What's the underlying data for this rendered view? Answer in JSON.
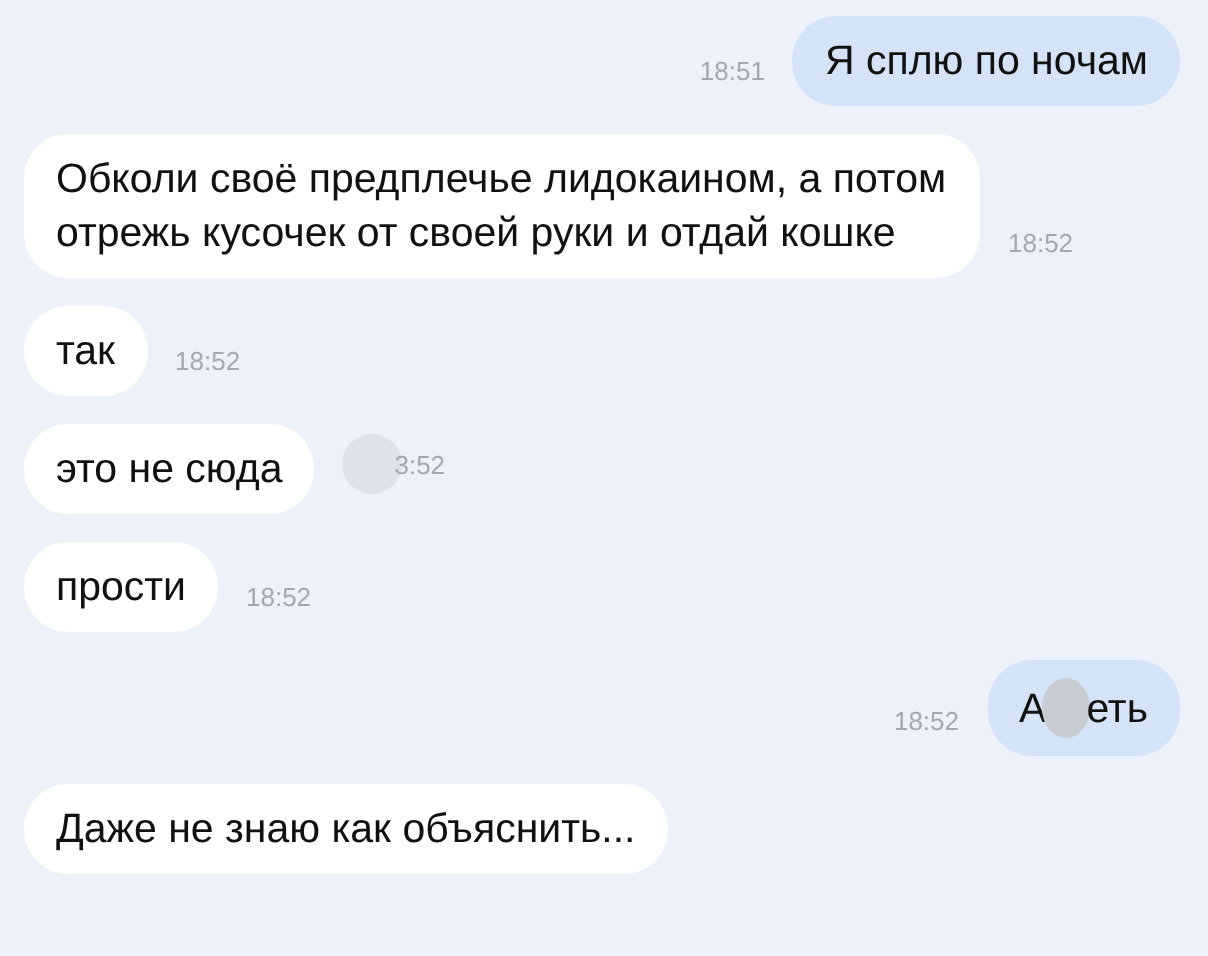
{
  "messages": [
    {
      "kind": "outgoing",
      "parts": [
        "Я сплю по ночам"
      ],
      "time": "18:51"
    },
    {
      "kind": "incoming",
      "parts": [
        "Обколи своё предплечье лидокаином, а потом отрежь кусочек от своей руки и отдай кошке"
      ],
      "time": "18:52"
    },
    {
      "kind": "incoming",
      "parts": [
        "так"
      ],
      "time": "18:52"
    },
    {
      "kind": "incoming",
      "parts": [
        "это не сюда"
      ],
      "time": "3:52",
      "time_blurred": true
    },
    {
      "kind": "incoming",
      "parts": [
        "прости"
      ],
      "time": "18:52"
    },
    {
      "kind": "outgoing",
      "parts": [
        "А",
        "еть"
      ],
      "time": "18:52"
    },
    {
      "kind": "incoming",
      "parts": [
        "Даже не знаю как объяснить..."
      ]
    }
  ]
}
